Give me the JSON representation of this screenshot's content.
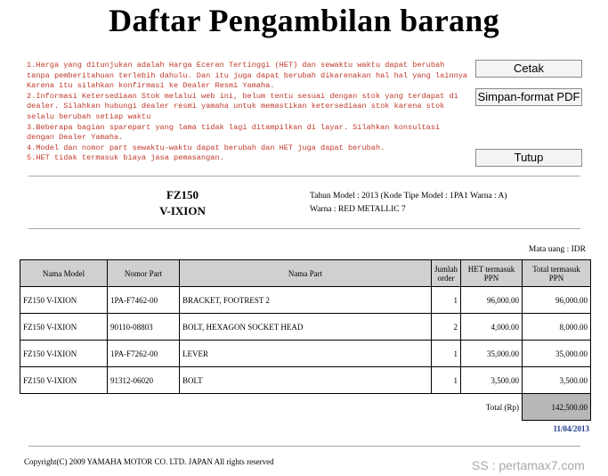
{
  "title": "Daftar Pengambilan barang",
  "notes": [
    "1.Harga yang ditunjukan adalah Harga Eceran Tertinggi (HET) dan sewaktu waktu dapat berubah tanpa pemberitahuan terlebih dahulu. Dan itu juga dapat berubah dikarenakan hal hal yang lainnya Karena itu silahkan konfirmasi ke Dealer Resmi Yamaha.",
    "2.Informasi Ketersediaan Stok melalui web ini, belum tentu sesuai dengan stok yang terdapat di dealer. Silahkan hubungi dealer resmi yamaha untuk memastikan ketersediaan stok karena stok selalu berubah setiap waktu",
    "3.Beberapa bagian sparepart yang lama tidak lagi ditampilkan di layar. Silahkan konsultasi dengan Dealer Yamaha.",
    "4.Model dan nomor part sewaktu-waktu dapat berubah dan HET juga dapat berubah.",
    "5.HET tidak termasuk biaya jasa pemasangan."
  ],
  "buttons": {
    "print": "Cetak",
    "save_pdf": "Simpan-format PDF",
    "close": "Tutup"
  },
  "model": {
    "code": "FZ150",
    "name": "V-IXION",
    "year_line": "Tahun Model :  2013 (Kode Tipe Model :  1PA1 Warna :  A)",
    "color_line": "Warna :  RED METALLIC 7"
  },
  "currency": "Mata uang :  IDR",
  "table": {
    "headers": {
      "model": "Nama Model",
      "part_no": "Nomor Part",
      "part_name": "Nama Part",
      "qty": "Jumlah order",
      "het": "HET termasuk PPN",
      "total": "Total termasuk PPN"
    },
    "rows": [
      {
        "model": "FZ150 V-IXION",
        "part_no": "1PA-F7462-00",
        "part_name": "BRACKET, FOOTREST 2",
        "qty": "1",
        "het": "96,000.00",
        "total": "96,000.00"
      },
      {
        "model": "FZ150 V-IXION",
        "part_no": "90110-08803",
        "part_name": "BOLT, HEXAGON SOCKET HEAD",
        "qty": "2",
        "het": "4,000.00",
        "total": "8,000.00"
      },
      {
        "model": "FZ150 V-IXION",
        "part_no": "1PA-F7262-00",
        "part_name": "LEVER",
        "qty": "1",
        "het": "35,000.00",
        "total": "35,000.00"
      },
      {
        "model": "FZ150 V-IXION",
        "part_no": "91312-06020",
        "part_name": "BOLT",
        "qty": "1",
        "het": "3,500.00",
        "total": "3,500.00"
      }
    ],
    "total_label": "Total (Rp)",
    "total_value": "142,500.00"
  },
  "date": "11/04/2013",
  "copyright": "Copyright(C) 2009 YAMAHA MOTOR CO. LTD. JAPAN All rights reserved",
  "watermark": "SS : pertamax7.com"
}
